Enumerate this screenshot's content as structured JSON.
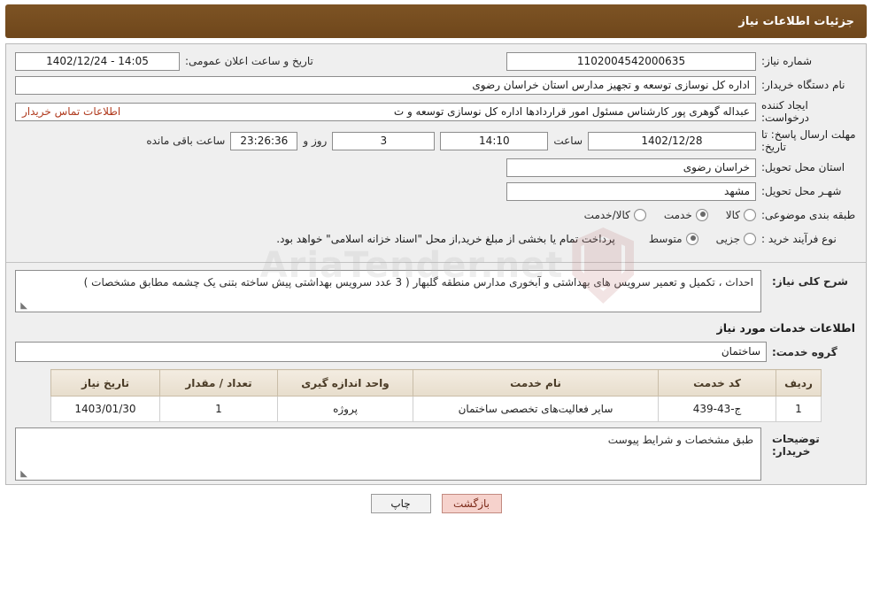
{
  "header": {
    "title": "جزئیات اطلاعات نیاز"
  },
  "form": {
    "need_number_label": "شماره نیاز:",
    "need_number_value": "1102004542000635",
    "announce_datetime_label": "تاریخ و ساعت اعلان عمومی:",
    "announce_datetime_value": "14:05 - 1402/12/24",
    "buyer_org_label": "نام دستگاه خریدار:",
    "buyer_org_value": "اداره کل نوسازی  توسعه و تجهیز مدارس استان خراسان رضوی",
    "creator_label": "ایجاد کننده درخواست:",
    "creator_value": "عبداله گوهری پور کارشناس مسئول امور قراردادها  اداره کل نوسازی  توسعه و ت",
    "creator_link": "اطلاعات تماس خریدار",
    "deadline_label": "مهلت ارسال پاسخ: تا تاریخ:",
    "deadline_date": "1402/12/28",
    "hour_label": "ساعت",
    "deadline_time": "14:10",
    "days_value": "3",
    "days_label": "روز و",
    "countdown_value": "23:26:36",
    "countdown_label": "ساعت باقی مانده",
    "province_label": "استان محل تحویل:",
    "province_value": "خراسان رضوی",
    "city_label": "شهـر محل تحویل:",
    "city_value": "مشهد",
    "category_label": "طبقه بندی موضوعی:",
    "category_options": [
      "کالا",
      "خدمت",
      "کالا/خدمت"
    ],
    "category_selected": "خدمت",
    "purchase_type_label": "نوع فرآیند خرید :",
    "purchase_type_options": [
      "جزیی",
      "متوسط"
    ],
    "purchase_type_selected": "متوسط",
    "purchase_note": "پرداخت تمام یا بخشی از مبلغ خرید,از محل \"اسناد خزانه اسلامی\" خواهد بود."
  },
  "description": {
    "label": "شرح کلی نیاز:",
    "value": "احداث ، تکمیل و تعمیر سرویس های بهداشتی و آبخوری مدارس منطقه گلبهار ( 3 عدد سرویس بهداشتی پیش ساخته بتنی یک چشمه مطابق مشخصات )"
  },
  "services": {
    "section_title": "اطلاعات خدمات مورد نیاز",
    "group_label": "گروه خدمت:",
    "group_value": "ساختمان",
    "columns": [
      "ردیف",
      "کد خدمت",
      "نام خدمت",
      "واحد اندازه گیری",
      "تعداد / مقدار",
      "تاریخ نیاز"
    ],
    "rows": [
      {
        "row": "1",
        "code": "ج-43-439",
        "name": "سایر فعالیت‌های تخصصی ساختمان",
        "unit": "پروژه",
        "qty": "1",
        "date": "1403/01/30"
      }
    ]
  },
  "buyer_notes": {
    "label": "توضیحات خریدار:",
    "value": "طبق مشخصات و شرایط پیوست"
  },
  "buttons": {
    "print": "چاپ",
    "back": "بازگشت"
  },
  "watermark": {
    "text": "AriaTender.net"
  }
}
